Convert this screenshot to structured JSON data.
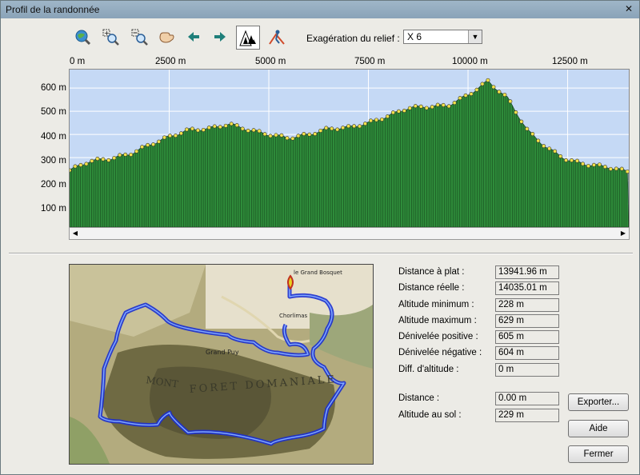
{
  "window": {
    "title": "Profil de la randonnée",
    "close_glyph": "✕"
  },
  "toolbar": {
    "icons": [
      "globe-zoom-icon",
      "zoom-in-icon",
      "zoom-out-icon",
      "hand-pan-icon",
      "arrow-left-icon",
      "arrow-right-icon",
      "forest-profile-icon",
      "hiker-icon"
    ],
    "exaggeration_label": "Exagération du relief :",
    "exaggeration_value": "X 6"
  },
  "chart_data": {
    "type": "area",
    "x_ticks": [
      "0 m",
      "2500 m",
      "5000 m",
      "7500 m",
      "10000 m",
      "12500 m"
    ],
    "y_ticks": [
      "600 m",
      "500 m",
      "400 m",
      "300 m",
      "200 m",
      "100 m"
    ],
    "xlim": [
      0,
      14035
    ],
    "ylim": [
      0,
      680
    ],
    "grid": true,
    "colors": {
      "fill": "#2e8b3a",
      "marker": "#f2e24a",
      "background": "#c5d9f5"
    },
    "x": [
      0,
      500,
      1000,
      1500,
      2000,
      2500,
      3000,
      3500,
      4000,
      4500,
      5000,
      5500,
      6000,
      6500,
      7000,
      7500,
      8000,
      8500,
      9000,
      9500,
      10000,
      10500,
      11000,
      11500,
      12000,
      12500,
      13000,
      13500,
      14000
    ],
    "y": [
      245,
      285,
      295,
      315,
      355,
      390,
      420,
      425,
      445,
      420,
      400,
      385,
      400,
      425,
      430,
      450,
      480,
      515,
      520,
      525,
      570,
      630,
      555,
      415,
      340,
      290,
      270,
      260,
      240
    ]
  },
  "stats": [
    {
      "label": "Distance à plat :",
      "value": "13941.96 m"
    },
    {
      "label": "Distance réelle :",
      "value": "14035.01 m"
    },
    {
      "label": "Altitude minimum :",
      "value": "228 m"
    },
    {
      "label": "Altitude maximum :",
      "value": "629 m"
    },
    {
      "label": "Dénivelée positive :",
      "value": "605 m"
    },
    {
      "label": "Dénivelée négative :",
      "value": "604 m"
    },
    {
      "label": "Diff. d'altitude :",
      "value": "0 m"
    }
  ],
  "cursor": [
    {
      "label": "Distance :",
      "value": "0.00 m"
    },
    {
      "label": "Altitude au sol :",
      "value": "229 m"
    }
  ],
  "buttons": {
    "export": "Exporter...",
    "help": "Aide",
    "close": "Fermer"
  },
  "map_labels": [
    "MONT",
    "FORET DOMANIALE",
    "Grand Puy",
    "le Grand Bosquet",
    "Chorlimas"
  ]
}
